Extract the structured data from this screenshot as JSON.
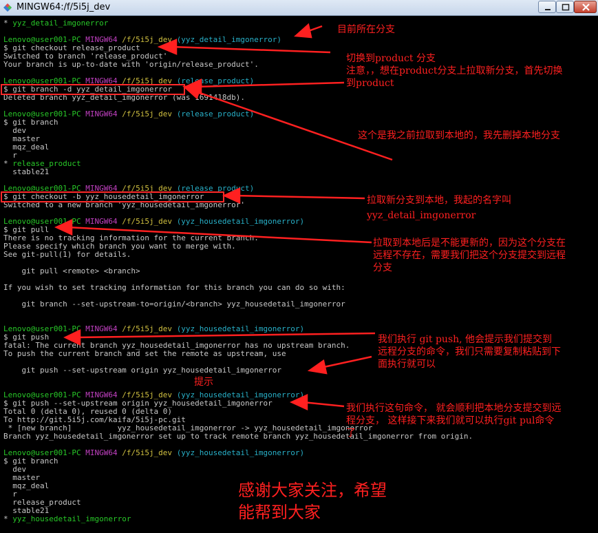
{
  "window": {
    "title": "MINGW64:/f/5i5j_dev"
  },
  "prompt": {
    "user": "Lenovo@user001-PC",
    "shell": "MINGW64",
    "path": "/f/5i5j_dev"
  },
  "terminal": {
    "l0": {
      "a": "* ",
      "b": "yyz_detail_imgonerror"
    },
    "l2": {
      "branch": "(yyz_detail_imgonerror)"
    },
    "l3": "$ git checkout release_product",
    "l4": "Switched to branch 'release_product'",
    "l5": "Your branch is up-to-date with 'origin/release_product'.",
    "l7": {
      "branch": "(release_product)"
    },
    "l8": "$ git branch -d yyz_detail_imgonerror",
    "l9": "Deleted branch yyz_detail_imgonerror (was 1691418db).",
    "l11": {
      "branch": "(release_product)"
    },
    "l12": "$ git branch",
    "l13": "  dev",
    "l14": "  master",
    "l15": "  mqz_deal",
    "l16": "  r",
    "l17": {
      "a": "* ",
      "b": "release_product"
    },
    "l18": "  stable21",
    "l20": {
      "branch": "(release_product)"
    },
    "l21": "$ git checkout -b yyz_housedetail_imgonerror",
    "l22": "Switched to a new branch 'yyz_housedetail_imgonerror'",
    "l24": {
      "branch": "(yyz_housedetail_imgonerror)"
    },
    "l25": "$ git pull",
    "l26": "There is no tracking information for the current branch.",
    "l27": "Please specify which branch you want to merge with.",
    "l28": "See git-pull(1) for details.",
    "l30": "    git pull <remote> <branch>",
    "l32": "If you wish to set tracking information for this branch you can do so with:",
    "l34": "    git branch --set-upstream-to=origin/<branch> yyz_housedetail_imgonerror",
    "l37": {
      "branch": "(yyz_housedetail_imgonerror)"
    },
    "l38": "$ git push",
    "l39": "fatal: The current branch yyz_housedetail_imgonerror has no upstream branch.",
    "l40": "To push the current branch and set the remote as upstream, use",
    "l42": "    git push --set-upstream origin yyz_housedetail_imgonerror",
    "l44": {
      "branch": "(yyz_housedetail_imgonerror)"
    },
    "l45": "$ git push --set-upstream origin yyz_housedetail_imgonerror",
    "l46": "Total 0 (delta 0), reused 0 (delta 0)",
    "l47": "To http://git.5i5j.com/kaifa/5i5j-pc.git",
    "l48": " * [new branch]          yyz_housedetail_imgonerror -> yyz_housedetail_imgonerror",
    "l49": "Branch yyz_housedetail_imgonerror set up to track remote branch yyz_housedetail_imgonerror from origin.",
    "l51": {
      "branch": "(yyz_housedetail_imgonerror)"
    },
    "l52": "$ git branch",
    "l53": "  dev",
    "l54": "  master",
    "l55": "  mqz_deal",
    "l56": "  r",
    "l57": "  release_product",
    "l58": "  stable21",
    "l59": {
      "a": "* ",
      "b": "yyz_housedetail_imgonerror"
    }
  },
  "notes": {
    "current_branch": "目前所在分支",
    "switch_1": "切换到product 分支",
    "switch_2": "注意，，想在product分支上拉取新分支，首先切换",
    "switch_3": "到product",
    "delete": "这个是我之前拉取到本地的，我先删掉本地分支",
    "pull_new_1": "拉取新分支到本地，我起的名字叫",
    "pull_new_2": "yyz_detail_imgonerror",
    "cannot_update_1": "拉取到本地后是不能更新的，因为这个分支在",
    "cannot_update_2": "远程不存在，需要我们把这个分支提交到远程",
    "cannot_update_3": "分支",
    "push_1": "我们执行 git push, 他会提示我们提交到",
    "push_2": "远程分支的命令，我们只需要复制粘贴到下",
    "push_3": "面执行就可以",
    "hint": "提示",
    "done_1": "我们执行这句命令， 就会顺利把本地分支提交到远",
    "done_2": "程分支，  这样接下来我们就可以执行git pul命令",
    "done_3": "了",
    "thanks_1": "感谢大家关注，希望",
    "thanks_2": "能帮到大家"
  },
  "colors": {
    "annotation": "#ff2020",
    "prompt_user": "#28c828",
    "prompt_shell": "#c040c0",
    "prompt_path": "#d0c040",
    "prompt_branch": "#28b0c8"
  }
}
